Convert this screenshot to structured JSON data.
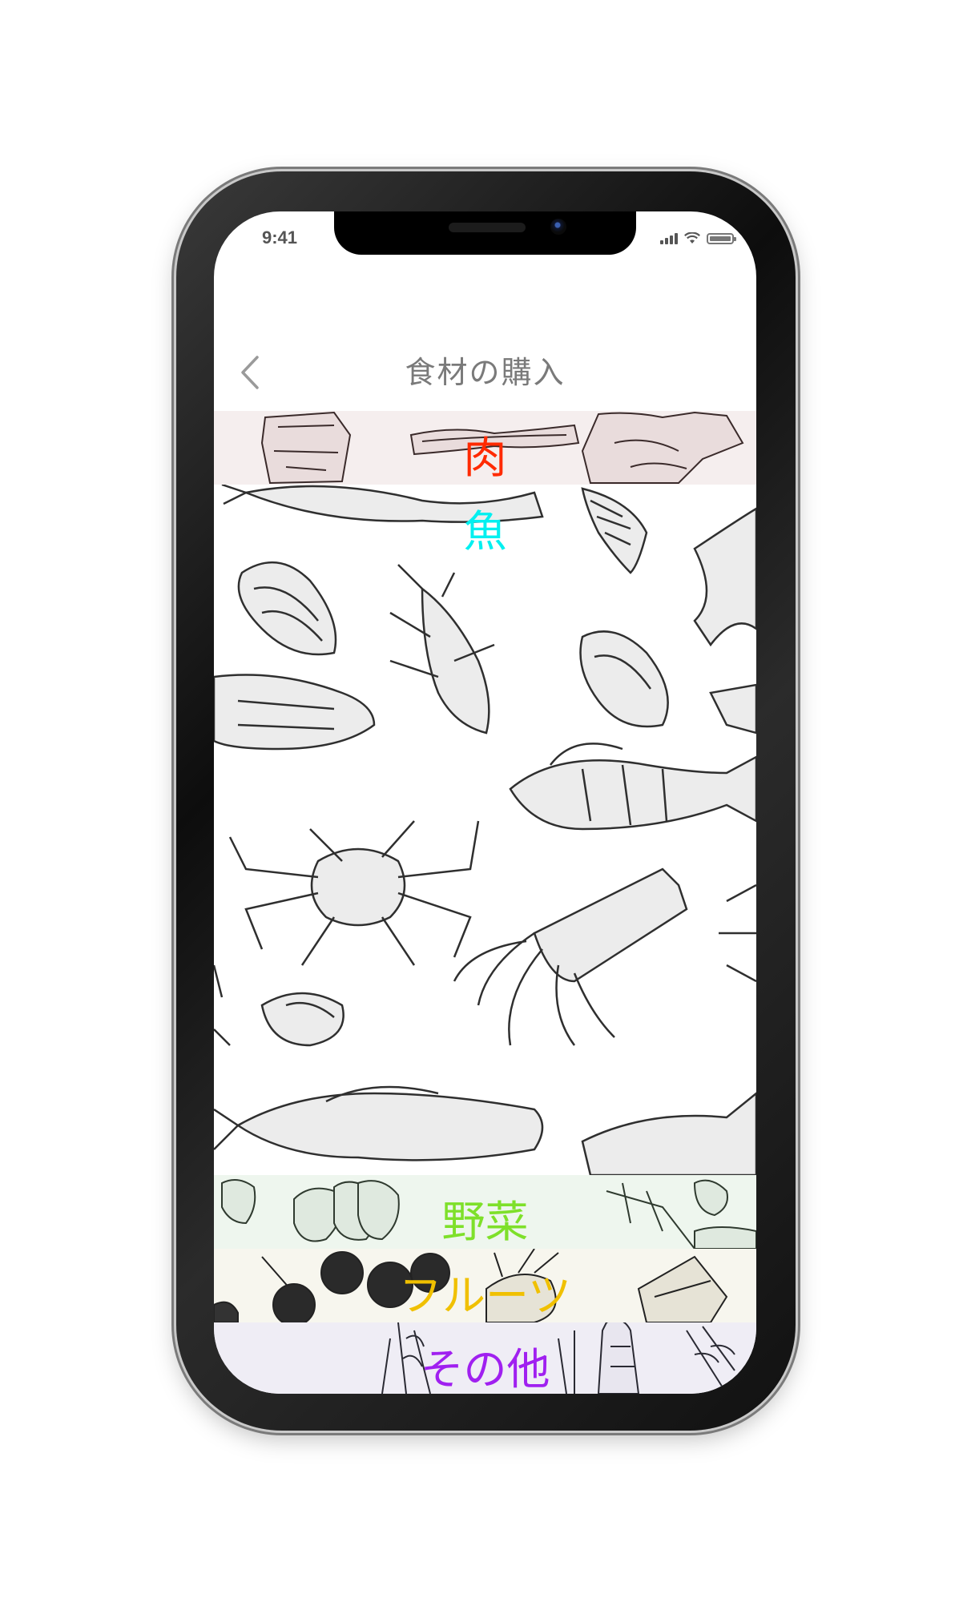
{
  "status_bar": {
    "time": "9:41"
  },
  "nav": {
    "title": "食材の購入",
    "back_icon": "chevron-left-icon"
  },
  "categories": [
    {
      "label": "肉",
      "color": "#ff2a00",
      "background": "#f5eeee"
    },
    {
      "label": "魚",
      "color": "#00f0f0",
      "background": "#ffffff"
    },
    {
      "label": "野菜",
      "color": "#7ee02a",
      "background": "#eef6ee"
    },
    {
      "label": "フルーツ",
      "color": "#f0c000",
      "background": "#f7f6ee"
    },
    {
      "label": "その他",
      "color": "#a020f0",
      "background": "#efedf5"
    }
  ]
}
